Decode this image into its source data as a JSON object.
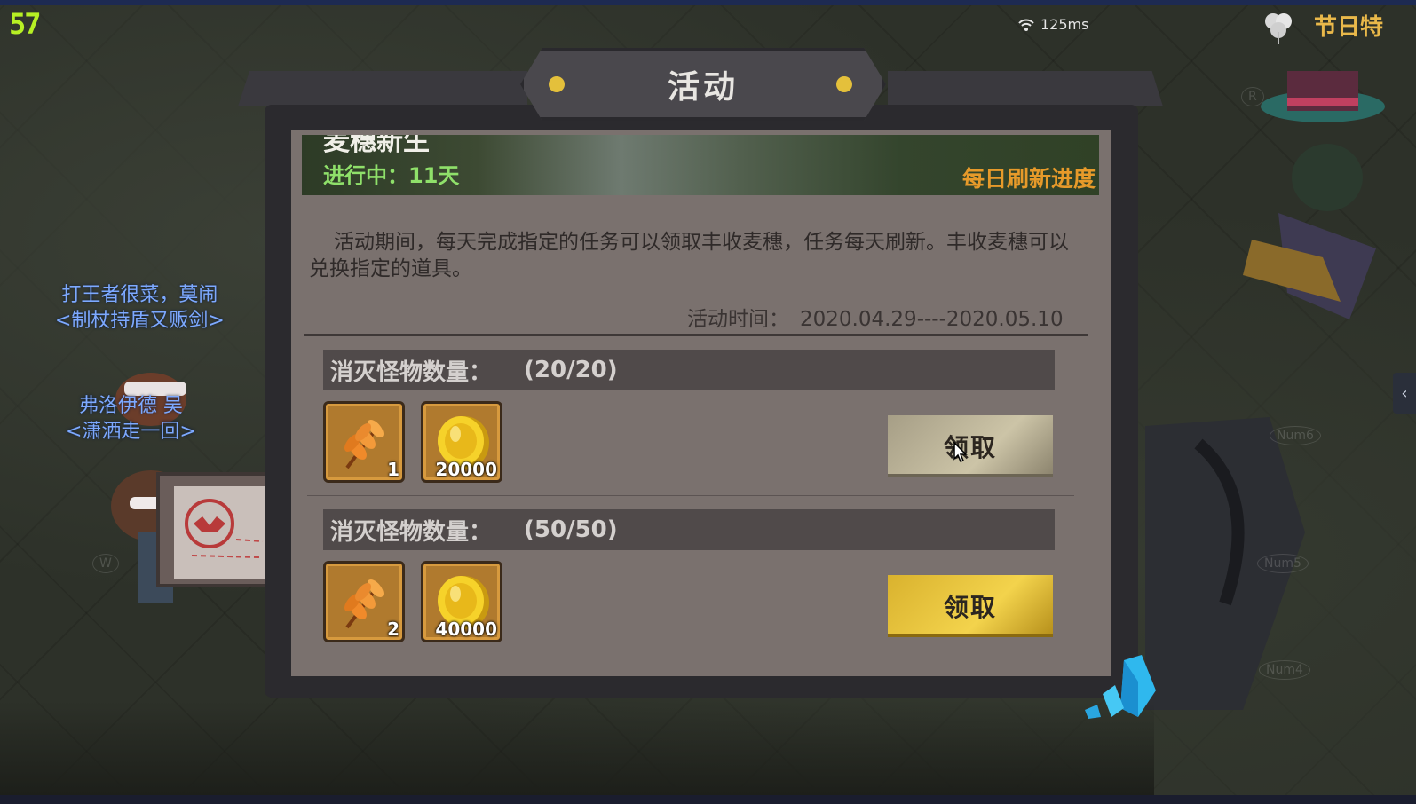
{
  "hud": {
    "fps": "57",
    "ping": "125ms",
    "holiday_label": "节日特"
  },
  "characters": [
    {
      "name_line1": "打王者很菜，莫闹",
      "name_line2": "<制杖持盾又贩剑>"
    },
    {
      "name_line1": "弗洛伊德 吴",
      "name_line2": "<潇洒走一回>"
    }
  ],
  "dialog": {
    "title": "活动",
    "banner": {
      "title": "麦穗新生",
      "status": "进行中：11天",
      "refresh_note": "每日刷新进度"
    },
    "description": "活动期间，每天完成指定的任务可以领取丰收麦穗，任务每天刷新。丰收麦穗可以兑换指定的道具。",
    "time_label": "活动时间：",
    "time_range": "2020.04.29----2020.05.10",
    "tasks": [
      {
        "label": "消灭怪物数量：",
        "progress": "(20/20)",
        "rewards": [
          {
            "icon": "wheat-icon",
            "count": "1"
          },
          {
            "icon": "gold-coin-icon",
            "count": "20000"
          }
        ],
        "button": "领取",
        "button_state": "claimed"
      },
      {
        "label": "消灭怪物数量：",
        "progress": "(50/50)",
        "rewards": [
          {
            "icon": "wheat-icon",
            "count": "2"
          },
          {
            "icon": "gold-coin-icon",
            "count": "40000"
          }
        ],
        "button": "领取",
        "button_state": "available"
      }
    ]
  },
  "colors": {
    "panel": "#7a716e",
    "task_header": "#504a4a",
    "button_active": "#f3d34c",
    "button_disabled": "#ccc4a7",
    "status_green": "#8fe06a",
    "refresh_orange": "#e79a2a"
  }
}
